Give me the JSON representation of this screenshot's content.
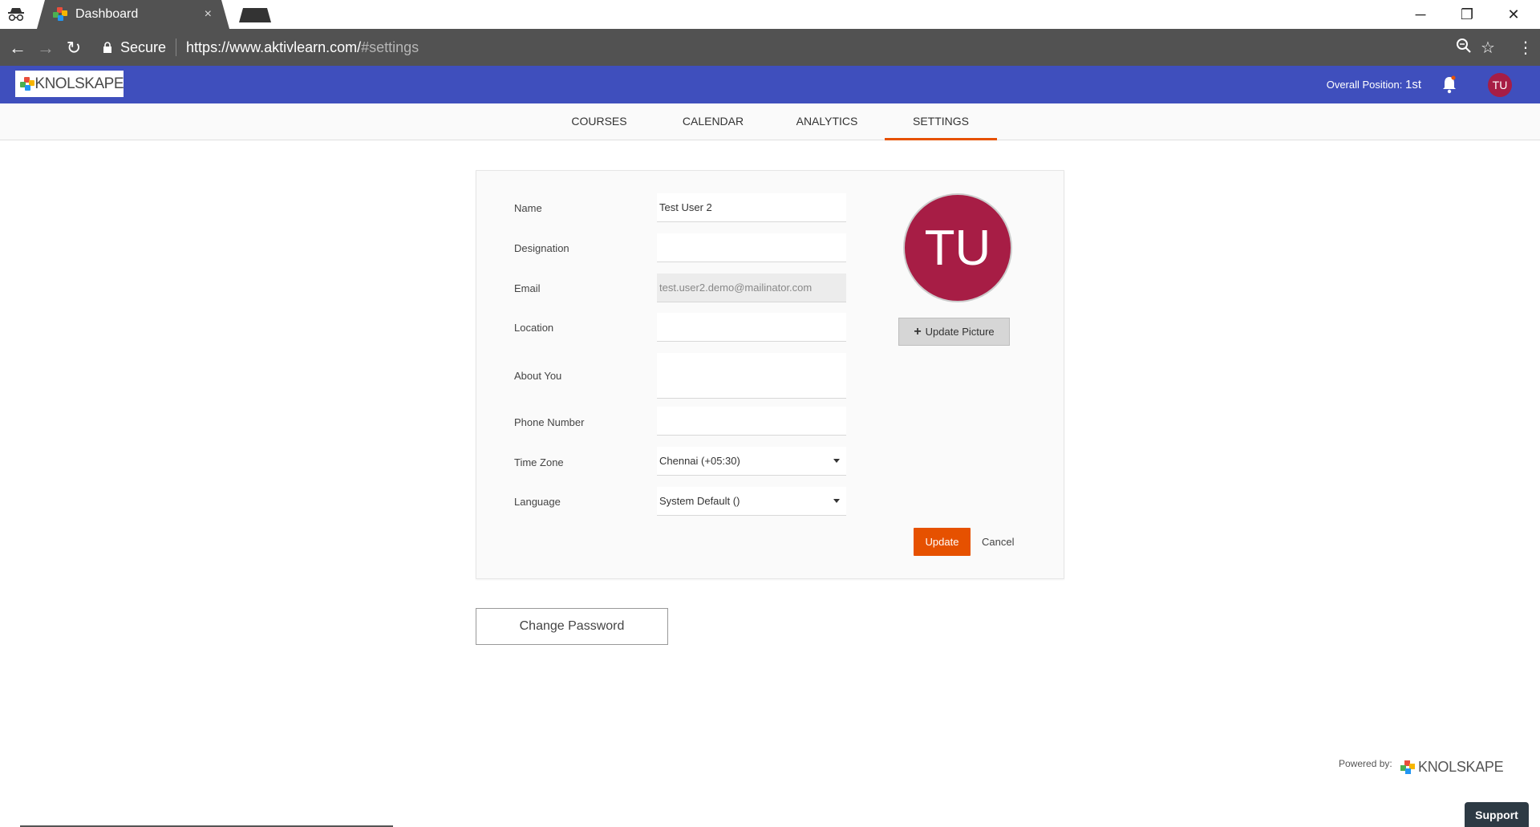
{
  "browser": {
    "tab_title": "Dashboard",
    "tab_close": "×",
    "url_secure": "Secure",
    "url_host": "https://www.aktivlearn.com/",
    "url_path": "#settings",
    "window_controls": {
      "minimize": "─",
      "restore": "❐",
      "close": "✕"
    }
  },
  "header": {
    "logo_text": "KNOLSKAPE",
    "overall_label": "Overall Position:",
    "overall_value": "1st",
    "avatar_initials": "TU",
    "brand_color": "#3f4fbd",
    "avatar_color": "#a71d45"
  },
  "nav": {
    "tabs": [
      {
        "label": "COURSES"
      },
      {
        "label": "CALENDAR"
      },
      {
        "label": "ANALYTICS"
      },
      {
        "label": "SETTINGS",
        "active": true
      }
    ],
    "accent_color": "#e65100"
  },
  "form": {
    "name_label": "Name",
    "name_value": "Test   User 2",
    "designation_label": "Designation",
    "designation_value": "",
    "email_label": "Email",
    "email_value": "test.user2.demo@mailinator.com",
    "location_label": "Location",
    "location_value": "",
    "about_label": "About You",
    "about_value": "",
    "phone_label": "Phone Number",
    "phone_value": "",
    "timezone_label": "Time Zone",
    "timezone_value": "Chennai (+05:30)",
    "language_label": "Language",
    "language_value": "System Default ()",
    "avatar_initials": "TU",
    "update_picture_label": "Update Picture",
    "update_label": "Update",
    "cancel_label": "Cancel"
  },
  "change_password_label": "Change Password",
  "footer": {
    "powered_by": "Powered by:",
    "logo_text": "KNOLSKAPE",
    "support_label": "Support"
  }
}
